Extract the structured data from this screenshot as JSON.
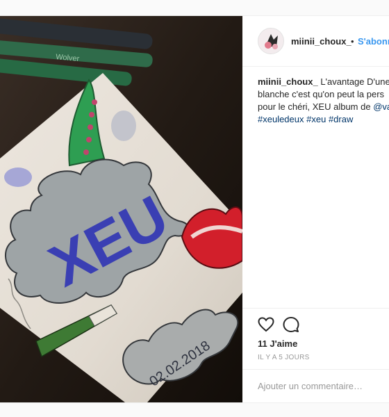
{
  "post": {
    "username": "miinii_choux_",
    "separator": "•",
    "follow_label": "S'abonner",
    "caption": {
      "line1_user": "miinii_choux_",
      "line1_text": " L'avantage D'une",
      "line2": "blanche c'est qu'on peut la pers",
      "line3_text": "pour le chéri, XEU album de ",
      "line3_mention": "@va",
      "hashtags": [
        "#xeuledeux",
        "#xeu",
        "#draw"
      ]
    },
    "likes": "11 J'aime",
    "timestamp": "IL Y A 5 JOURS",
    "comment_placeholder": "Ajouter un commentaire…"
  },
  "artwork": {
    "title_text": "XEU",
    "date_text": "02.02.2018",
    "marker_text": "Wolver"
  },
  "icons": {
    "like": "heart-icon",
    "comment": "comment-icon"
  },
  "colors": {
    "link": "#3897f0",
    "hashtag": "#003569",
    "text": "#262626",
    "muted": "#999999"
  }
}
